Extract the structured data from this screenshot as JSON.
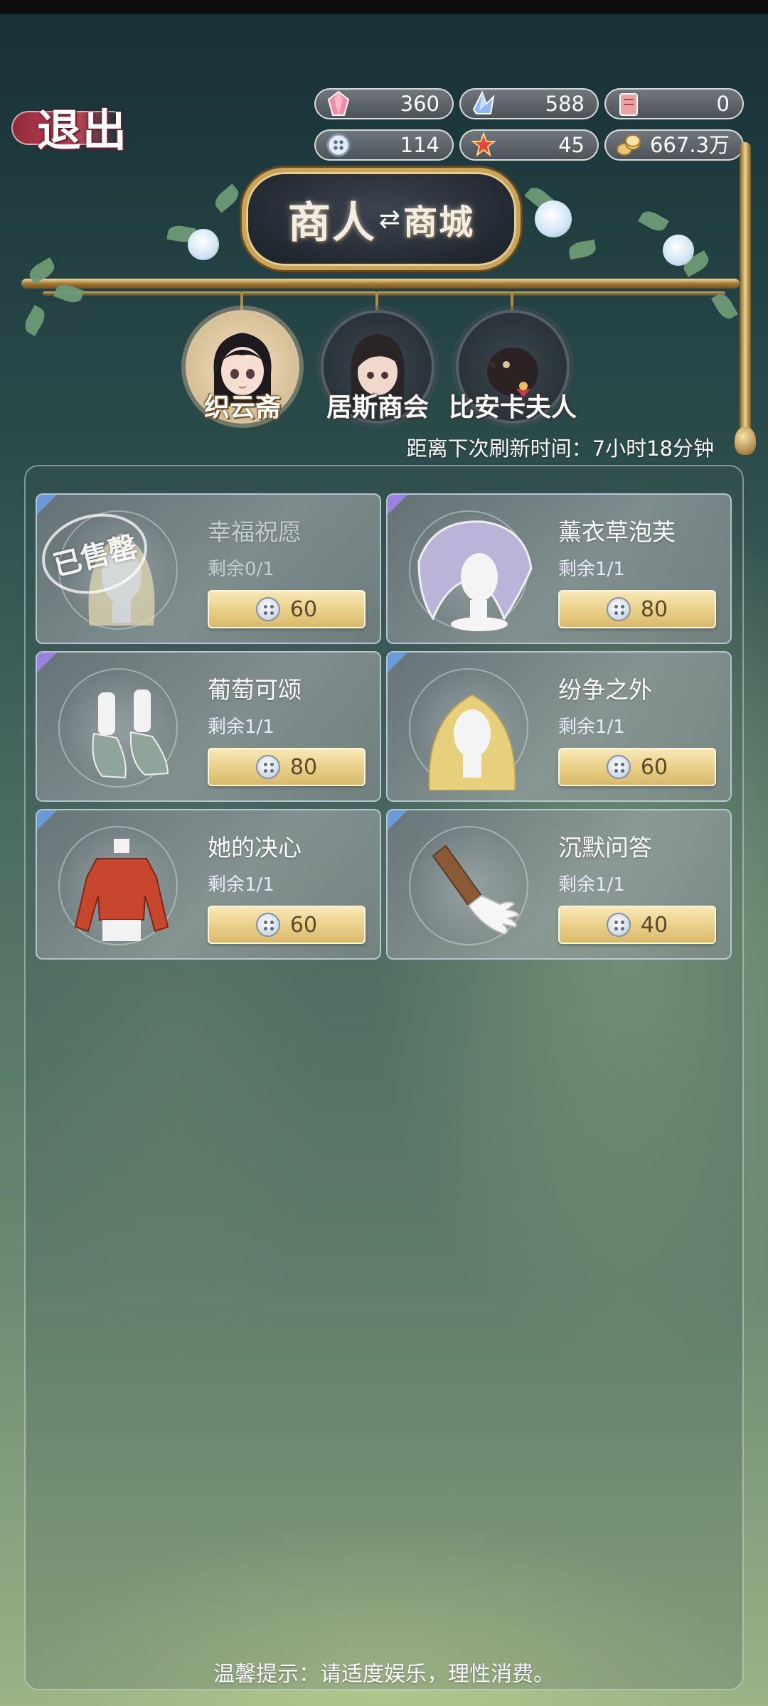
{
  "exit": {
    "label": "退出"
  },
  "currencies": [
    {
      "icon": "pink-gem-icon",
      "value": "360"
    },
    {
      "icon": "blue-crystal-icon",
      "value": "588"
    },
    {
      "icon": "scroll-ticket-icon",
      "value": "0"
    },
    {
      "icon": "button-token-icon",
      "value": "114"
    },
    {
      "icon": "red-star-icon",
      "value": "45"
    },
    {
      "icon": "gold-coin-icon",
      "value": "667.3万"
    }
  ],
  "header": {
    "title_left": "商人",
    "title_right": "商城"
  },
  "merchants": [
    {
      "label": "织云斋",
      "active": true
    },
    {
      "label": "居斯商会",
      "active": false
    },
    {
      "label": "比安卡夫人",
      "active": false
    }
  ],
  "refresh": {
    "text": "距离下次刷新时间：7小时18分钟"
  },
  "items": [
    {
      "name": "幸福祝愿",
      "stock": "剩余0/1",
      "price": "60",
      "sold_out": true,
      "sold_out_label": "已售罄",
      "thumb": "wig-icon",
      "corner": "blue"
    },
    {
      "name": "薰衣草泡芙",
      "stock": "剩余1/1",
      "price": "80",
      "thumb": "lace-bonnet-icon",
      "corner": "purple"
    },
    {
      "name": "葡萄可颂",
      "stock": "剩余1/1",
      "price": "80",
      "thumb": "shoes-icon",
      "corner": "purple"
    },
    {
      "name": "纷争之外",
      "stock": "剩余1/1",
      "price": "60",
      "thumb": "blonde-hair-icon",
      "corner": "blue"
    },
    {
      "name": "她的决心",
      "stock": "剩余1/1",
      "price": "60",
      "thumb": "red-blouse-icon",
      "corner": "blue"
    },
    {
      "name": "沉默问答",
      "stock": "剩余1/1",
      "price": "40",
      "thumb": "glove-icon",
      "corner": "blue"
    }
  ],
  "footer": {
    "tip": "温馨提示：请适度娱乐，理性消费。"
  },
  "colors": {
    "price_button": "#ead08a",
    "corner_blue": "#6a9ad8",
    "corner_purple": "#9a82e0"
  }
}
